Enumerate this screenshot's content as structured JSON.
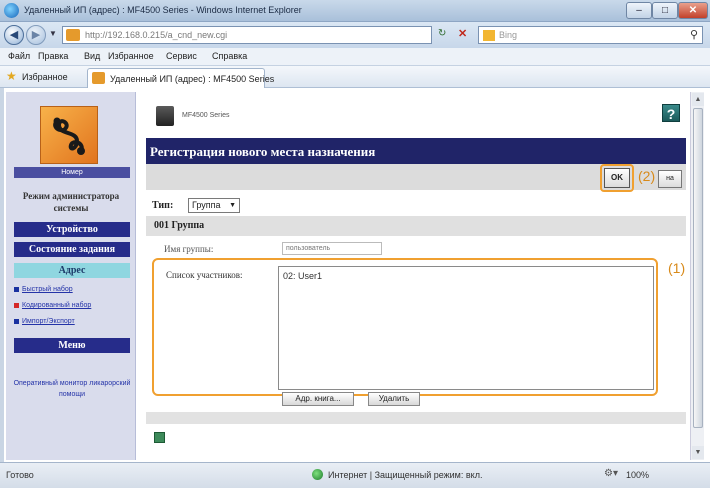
{
  "window": {
    "title": "Удаленный ИП (адрес) : MF4500 Series - Windows Internet Explorer",
    "min": "–",
    "max": "□",
    "close": "✕"
  },
  "nav": {
    "url": "http://192.168.0.215/a_cnd_new.cgi",
    "search_placeholder": "Bing",
    "search_icon": "⚲",
    "refresh_icon": "↻",
    "stop_icon": "✕"
  },
  "menu": [
    "Файл",
    "Правка",
    "Вид",
    "Избранное",
    "Сервис",
    "Справка"
  ],
  "favorites": {
    "label": "Избранное",
    "tab_label": "Удаленный ИП (адрес) : MF4500 Series"
  },
  "sidebar": {
    "logo_caption": "Номер",
    "admin_mode": "Режим администратора системы",
    "buttons": {
      "device": "Устройство",
      "job_status": "Состояние задания",
      "address": "Адрес",
      "menu": "Меню"
    },
    "links": [
      "Быстрый набор",
      "Кодированный набор",
      "Импорт/Экспорт"
    ],
    "bottom_link": "Оперативный монитор ликарорский помощи"
  },
  "main": {
    "printer_name": "MF4500 Series",
    "help_icon": "?",
    "page_title": "Регистрация нового места назначения",
    "ok_label": "OK",
    "cancel_label": "на",
    "annotation_2": "(2)",
    "annotation_1": "(1)",
    "type_label": "Тип:",
    "type_value": "Группа",
    "group_label": "001 Группа",
    "name_label": "Имя группы:",
    "name_value": "пользователь",
    "members_label": "Список участников:",
    "members": [
      "02: User1"
    ],
    "add_address_label": "Адр. книга...",
    "delete_label": "Удалить"
  },
  "status": {
    "ready": "Готово",
    "zone": "Интернет | Защищенный режим: вкл.",
    "zoom": "100%"
  },
  "colors": {
    "header_navy": "#202468",
    "sidebar_button": "#262c8a",
    "active_button": "#8fd6e0",
    "highlight": "#f0a030"
  }
}
